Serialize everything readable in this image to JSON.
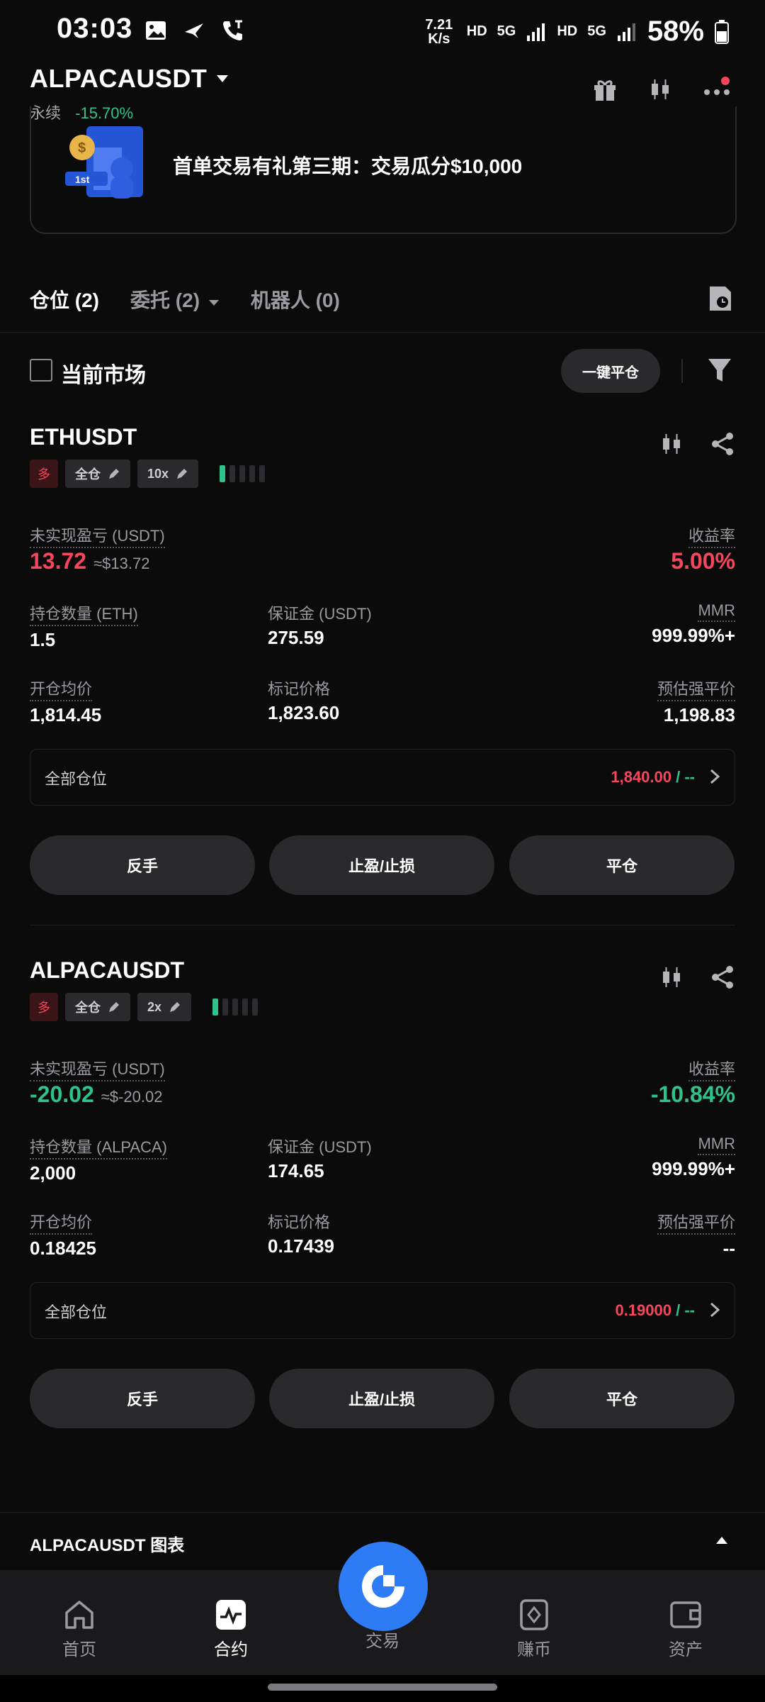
{
  "status": {
    "time": "03:03",
    "speed": "7.21\nK/s",
    "hd1": "HD",
    "net1": "5G",
    "hd2": "HD",
    "net2": "5G",
    "battery": "58%"
  },
  "header": {
    "pair": "ALPACAUSDT",
    "type": "永续",
    "change": "-15.70%"
  },
  "banner": {
    "text": "首单交易有礼第三期：交易瓜分$10,000"
  },
  "tabs": [
    {
      "label": "仓位 (2)"
    },
    {
      "label": "委托 (2)"
    },
    {
      "label": "机器人 (0)"
    }
  ],
  "filter": {
    "label": "当前市场",
    "close_all": "一键平仓"
  },
  "positions": [
    {
      "symbol": "ETHUSDT",
      "side": "多",
      "margin_mode": "全仓",
      "leverage": "10x",
      "adl_level": 1,
      "upnl_label": "未实现盈亏 (USDT)",
      "upnl": "13.72",
      "upnl_usd": "≈$13.72",
      "roe_label": "收益率",
      "roe": "5.00%",
      "size_label": "持仓数量 (ETH)",
      "size": "1.5",
      "margin_label": "保证金 (USDT)",
      "margin": "275.59",
      "mmr_label": "MMR",
      "mmr": "999.99%+",
      "entry_label": "开仓均价",
      "entry": "1,814.45",
      "mark_label": "标记价格",
      "mark": "1,823.60",
      "liq_label": "预估强平价",
      "liq": "1,198.83",
      "all_label": "全部仓位",
      "all_value": "1,840.00",
      "all_suffix": " / --",
      "btn_reverse": "反手",
      "btn_tpsl": "止盈/止损",
      "btn_close": "平仓"
    },
    {
      "symbol": "ALPACAUSDT",
      "side": "多",
      "margin_mode": "全仓",
      "leverage": "2x",
      "adl_level": 1,
      "upnl_label": "未实现盈亏 (USDT)",
      "upnl": "-20.02",
      "upnl_usd": "≈$-20.02",
      "roe_label": "收益率",
      "roe": "-10.84%",
      "size_label": "持仓数量 (ALPACA)",
      "size": "2,000",
      "margin_label": "保证金 (USDT)",
      "margin": "174.65",
      "mmr_label": "MMR",
      "mmr": "999.99%+",
      "entry_label": "开仓均价",
      "entry": "0.18425",
      "mark_label": "标记价格",
      "mark": "0.17439",
      "liq_label": "预估强平价",
      "liq": "--",
      "all_label": "全部仓位",
      "all_value": "0.19000",
      "all_suffix": " / --",
      "btn_reverse": "反手",
      "btn_tpsl": "止盈/止损",
      "btn_close": "平仓"
    }
  ],
  "chart_bar": {
    "label": "ALPACAUSDT 图表"
  },
  "nav": [
    {
      "label": "首页",
      "icon": "home-icon"
    },
    {
      "label": "合约",
      "icon": "futures-icon"
    },
    {
      "label": "交易",
      "icon": "trade-icon"
    },
    {
      "label": "赚币",
      "icon": "earn-icon"
    },
    {
      "label": "资产",
      "icon": "wallet-icon"
    }
  ],
  "colors": {
    "accent": "#2d7cf6",
    "up": "#2fc28a",
    "down": "#f6465d",
    "warn": "#f5a96b"
  }
}
